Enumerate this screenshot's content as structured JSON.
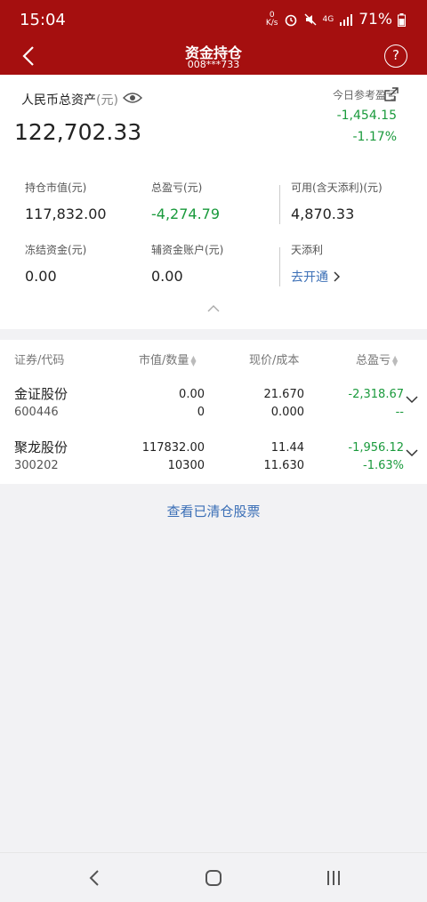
{
  "status_bar": {
    "time": "15:04",
    "net_speed_top": "0",
    "net_speed_bottom": "K/s",
    "network_type": "4G",
    "battery": "71%"
  },
  "header": {
    "title": "资金持仓",
    "account": "008***733",
    "help_label": "?"
  },
  "assets": {
    "total_label": "人民币总资产",
    "total_unit": "(元)",
    "total_value": "122,702.33",
    "today_label": "今日参考盈亏",
    "today_amount": "-1,454.15",
    "today_percent": "-1.17%",
    "market_value_label": "持仓市值(元)",
    "market_value": "117,832.00",
    "total_pl_label": "总盈亏(元)",
    "total_pl": "-4,274.79",
    "available_label": "可用(含天添利)(元)",
    "available": "4,870.33",
    "frozen_label": "冻结资金(元)",
    "frozen": "0.00",
    "aux_label": "辅资金账户(元)",
    "aux": "0.00",
    "tiantianli_label": "天添利",
    "tiantianli_link": "去开通"
  },
  "holdings": {
    "headers": {
      "security": "证券/代码",
      "value_qty": "市值/数量",
      "price_cost": "现价/成本",
      "total_pl": "总盈亏"
    },
    "rows": [
      {
        "name": "金证股份",
        "code": "600446",
        "value": "0.00",
        "qty": "0",
        "price": "21.670",
        "cost": "0.000",
        "pl": "-2,318.67",
        "pl_pct": "--"
      },
      {
        "name": "聚龙股份",
        "code": "300202",
        "value": "117832.00",
        "qty": "10300",
        "price": "11.44",
        "cost": "11.630",
        "pl": "-1,956.12",
        "pl_pct": "-1.63%"
      }
    ]
  },
  "cleared_link": "查看已清仓股票",
  "colors": {
    "brand_red": "#a50f0f",
    "loss_green": "#1a9a3c",
    "link_blue": "#3b6fb6"
  }
}
